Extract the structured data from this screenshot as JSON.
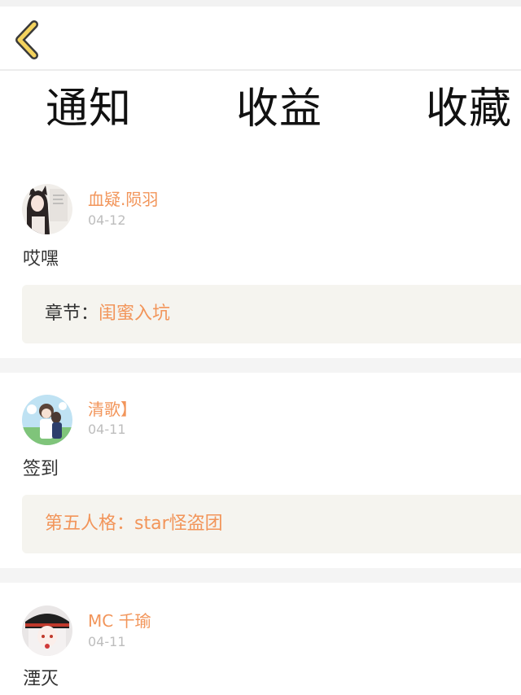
{
  "header": {
    "back_icon": "chevron-left-icon",
    "accent_color": "#f2955a"
  },
  "tabs": [
    {
      "label": "通知"
    },
    {
      "label": "收益"
    },
    {
      "label": "收藏"
    }
  ],
  "notifications": [
    {
      "username": "血疑.陨羽",
      "date": "04-12",
      "message": "哎嘿",
      "ref_label": "章节：",
      "ref_link": "闺蜜入坑"
    },
    {
      "username": "清歌】",
      "date": "04-11",
      "message": "签到",
      "ref_label": "",
      "ref_link": "第五人格：star怪盗团"
    },
    {
      "username": "MC 千瑜",
      "date": "04-11",
      "message": "湮灭"
    }
  ]
}
